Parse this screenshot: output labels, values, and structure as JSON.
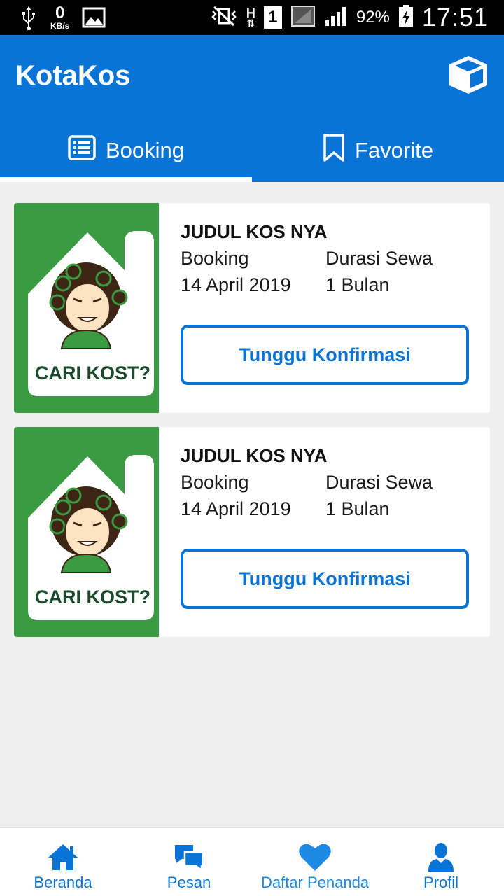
{
  "status_bar": {
    "speed_value": "0",
    "speed_unit": "KB/s",
    "network_type": "H",
    "sim_slot": "1",
    "battery_percent": "92%",
    "time": "17:51"
  },
  "app_bar": {
    "title": "KotaKos",
    "action_icon": "box-icon"
  },
  "tabs": [
    {
      "label": "Booking",
      "icon": "list-icon",
      "active": true
    },
    {
      "label": "Favorite",
      "icon": "bookmark-icon",
      "active": false
    }
  ],
  "bookings": [
    {
      "image_text": "CARI KOST?",
      "title": "JUDUL KOS NYA",
      "booking_label": "Booking",
      "booking_date": "14 April 2019",
      "duration_label": "Durasi Sewa",
      "duration_value": "1 Bulan",
      "status_button": "Tunggu Konfirmasi"
    },
    {
      "image_text": "CARI KOST?",
      "title": "JUDUL KOS NYA",
      "booking_label": "Booking",
      "booking_date": "14 April 2019",
      "duration_label": "Durasi Sewa",
      "duration_value": "1 Bulan",
      "status_button": "Tunggu Konfirmasi"
    }
  ],
  "bottom_nav": [
    {
      "label": "Beranda",
      "icon": "home-icon",
      "active": false
    },
    {
      "label": "Pesan",
      "icon": "chat-icon",
      "active": false
    },
    {
      "label": "Daftar Penanda",
      "icon": "heart-icon",
      "active": true
    },
    {
      "label": "Profil",
      "icon": "person-icon",
      "active": false
    }
  ],
  "colors": {
    "primary": "#0a74d6",
    "background": "#efefef",
    "image_green": "#3a9b43",
    "active_nav": "#1e88e5"
  }
}
